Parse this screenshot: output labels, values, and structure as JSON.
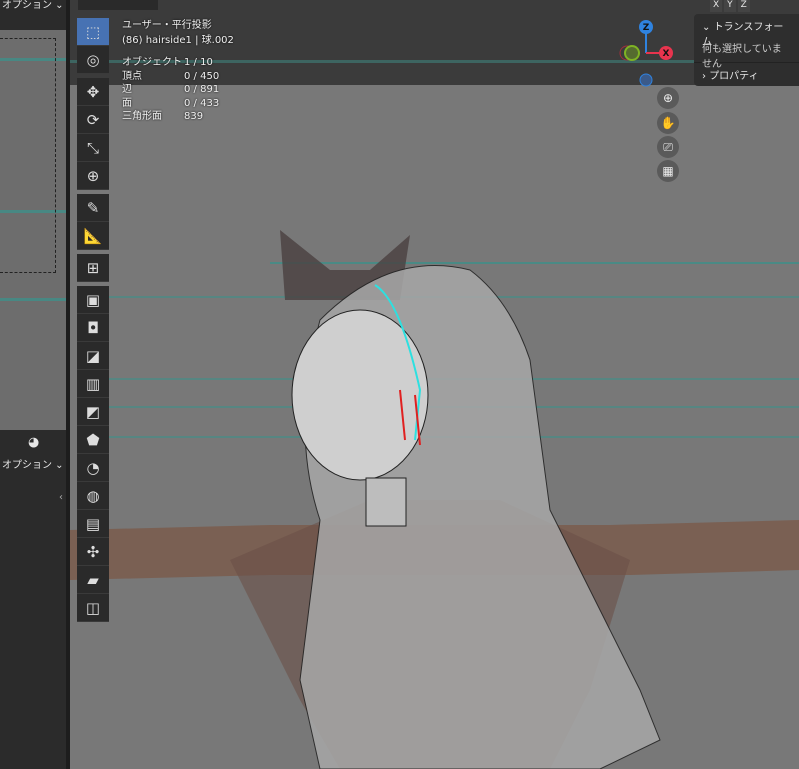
{
  "left_panel": {
    "header_option": "オプション ⌄",
    "lower_option": "オプション ⌄"
  },
  "overlay": {
    "view_name": "ユーザー・平行投影",
    "object_name": "(86) hairside1 | 球.002",
    "stats": [
      {
        "label": "オブジェクト",
        "value": "1 / 10"
      },
      {
        "label": "頂点",
        "value": "0 / 450"
      },
      {
        "label": "辺",
        "value": "0 / 891"
      },
      {
        "label": "面",
        "value": "0 / 433"
      },
      {
        "label": "三角形面",
        "value": "839"
      }
    ]
  },
  "header": {
    "axis_buttons": [
      "X",
      "Y",
      "Z"
    ]
  },
  "gizmo": {
    "z": "Z",
    "x": "X",
    "colors": {
      "x": "#e8344e",
      "y": "#7fb324",
      "z": "#2f83e0"
    }
  },
  "sidebar": {
    "transform_label": "トランスフォーム",
    "empty_text": "何も選択していません",
    "properties_label": "プロパティ"
  },
  "toolbar": {
    "tools": [
      {
        "name": "select-box",
        "glyph": "⬚"
      },
      {
        "name": "cursor",
        "glyph": "◎"
      },
      {
        "name": "move",
        "glyph": "✥"
      },
      {
        "name": "rotate",
        "glyph": "⟳"
      },
      {
        "name": "scale",
        "glyph": "⤡"
      },
      {
        "name": "transform",
        "glyph": "⊕"
      },
      {
        "name": "annotate",
        "glyph": "✎"
      },
      {
        "name": "measure",
        "glyph": "📐"
      },
      {
        "name": "add-cube",
        "glyph": "⊞"
      },
      {
        "name": "extrude-region",
        "glyph": "▣"
      },
      {
        "name": "inset-faces",
        "glyph": "◘"
      },
      {
        "name": "bevel",
        "glyph": "◪"
      },
      {
        "name": "loop-cut",
        "glyph": "▥"
      },
      {
        "name": "knife",
        "glyph": "◩"
      },
      {
        "name": "poly-build",
        "glyph": "⬟"
      },
      {
        "name": "spin",
        "glyph": "◔"
      },
      {
        "name": "smooth",
        "glyph": "◍"
      },
      {
        "name": "edge-slide",
        "glyph": "▤"
      },
      {
        "name": "shrink-fatten",
        "glyph": "✣"
      },
      {
        "name": "shear",
        "glyph": "▰"
      },
      {
        "name": "rip-region",
        "glyph": "◫"
      }
    ]
  }
}
